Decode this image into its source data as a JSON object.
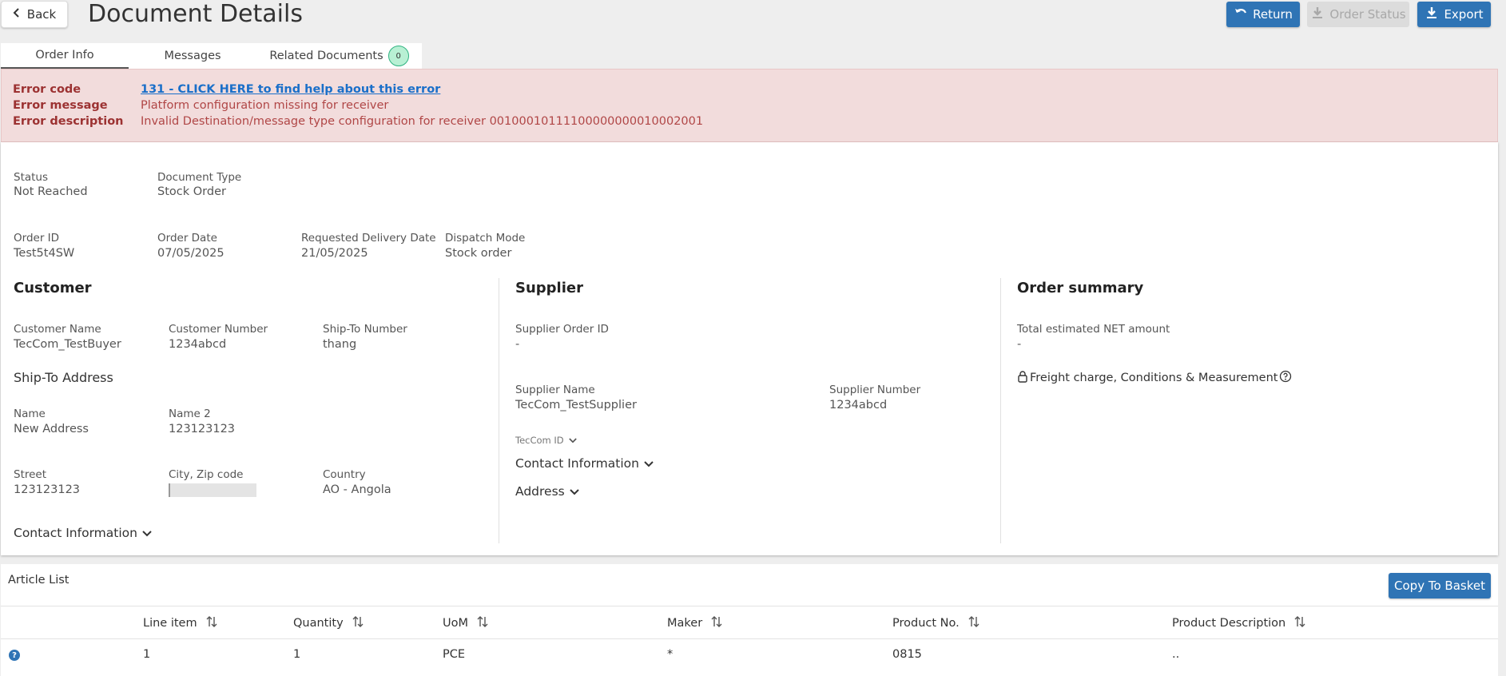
{
  "header": {
    "back_label": "Back",
    "title": "Document Details",
    "return_label": "Return",
    "order_status_label": "Order Status",
    "export_label": "Export"
  },
  "tabs": [
    {
      "label": "Order Info",
      "active": true
    },
    {
      "label": "Messages",
      "active": false
    },
    {
      "label": "Related Documents",
      "badge": "0",
      "active": false
    }
  ],
  "error": {
    "code_label": "Error code",
    "code_value": "131 - CLICK HERE to find help about this error",
    "message_label": "Error message",
    "message_value": "Platform configuration missing for receiver",
    "description_label": "Error description",
    "description_value": "Invalid Destination/message type configuration for receiver 00100010111100000000010002001"
  },
  "order": {
    "status_label": "Status",
    "status": "Not Reached",
    "doc_type_label": "Document Type",
    "doc_type": "Stock Order",
    "order_id_label": "Order ID",
    "order_id": "Test5t4SW",
    "order_date_label": "Order Date",
    "order_date": "07/05/2025",
    "req_delivery_label": "Requested Delivery Date",
    "req_delivery": "21/05/2025",
    "dispatch_label": "Dispatch Mode",
    "dispatch": "Stock order"
  },
  "customer": {
    "title": "Customer",
    "name_label": "Customer Name",
    "name": "TecCom_TestBuyer",
    "number_label": "Customer Number",
    "number": "1234abcd",
    "shipto_label": "Ship-To Number",
    "shipto": "thang",
    "address_title": "Ship-To Address",
    "addr_name_label": "Name",
    "addr_name": "New Address",
    "addr_name2_label": "Name 2",
    "addr_name2": "123123123",
    "street_label": "Street",
    "street": "123123123",
    "city_label": "City, Zip code",
    "country_label": "Country",
    "country": "AO - Angola",
    "contact_label": "Contact Information"
  },
  "supplier": {
    "title": "Supplier",
    "order_id_label": "Supplier Order ID",
    "order_id": "-",
    "name_label": "Supplier Name",
    "name": "TecCom_TestSupplier",
    "number_label": "Supplier Number",
    "number": "1234abcd",
    "teccom_id_label": "TecCom ID",
    "contact_label": "Contact Information",
    "address_label": "Address"
  },
  "summary": {
    "title": "Order summary",
    "net_label": "Total estimated NET amount",
    "net": "-",
    "freight_label": "Freight charge, Conditions & Measurement"
  },
  "articles": {
    "title": "Article List",
    "copy_label": "Copy To Basket",
    "columns": [
      "Line item",
      "Quantity",
      "UoM",
      "Maker",
      "Product No.",
      "Product Description"
    ],
    "rows": [
      {
        "help": "?",
        "line": "1",
        "quantity": "1",
        "uom": "PCE",
        "maker": "*",
        "product_no": "0815",
        "description": ".."
      }
    ]
  },
  "colors": {
    "accent": "#2f74b5",
    "error_bg": "#f2dcdc",
    "error_text": "#9c3232"
  }
}
